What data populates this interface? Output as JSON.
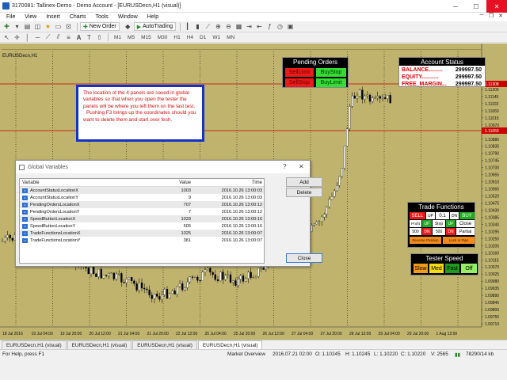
{
  "window": {
    "title": "3170081: Tallinex-Demo - Demo Account - [EURUSDecn,H1 (visual)]"
  },
  "menu": [
    "File",
    "View",
    "Insert",
    "Charts",
    "Tools",
    "Window",
    "Help"
  ],
  "toolbar": {
    "new_order": "New Order",
    "autotrading": "AutoTrading",
    "timeframes": [
      "M1",
      "M5",
      "M15",
      "M30",
      "H1",
      "H4",
      "D1",
      "W1",
      "MN"
    ]
  },
  "chart": {
    "symbol_label": "EURUSDecn,H1",
    "price_levels": [
      "1.11308",
      "1.11205",
      "1.11145",
      "1.11102",
      "1.11060",
      "1.11015",
      "1.10970",
      "1.10925",
      "1.10880",
      "1.10835",
      "1.10790",
      "1.10745",
      "1.10700",
      "1.10655",
      "1.10610",
      "1.10565",
      "1.10520",
      "1.10475",
      "1.10430",
      "1.10385",
      "1.10340",
      "1.10295",
      "1.10250",
      "1.10205",
      "1.10160",
      "1.10115",
      "1.10070",
      "1.10025",
      "1.09980",
      "1.09935",
      "1.09890",
      "1.09845",
      "1.09800",
      "1.09755",
      "1.09710"
    ],
    "price_line_top": "1.11308",
    "price_line_mid": "1.11050",
    "time_labels": [
      "18 Jul 2016",
      "19 Jul 04:00",
      "19 Jul 20:00",
      "20 Jul 12:00",
      "21 Jul 04:00",
      "21 Jul 20:00",
      "22 Jul 12:00",
      "25 Jul 04:00",
      "25 Jul 20:00",
      "26 Jul 12:00",
      "27 Jul 04:00",
      "27 Jul 20:00",
      "28 Jul 12:00",
      "29 Jul 04:00",
      "29 Jul 20:00",
      "1 Aug 12:00"
    ],
    "colors": {
      "background": "#bfb36d",
      "bull": "#ffffff",
      "bear": "#000000",
      "level": "#cc0000"
    }
  },
  "pending_orders": {
    "title": "Pending Orders",
    "sell_limit": "SellLimit",
    "buy_stop": "BuyStop",
    "sell_stop": "SellStop",
    "buy_limit": "BuyLimit"
  },
  "account_status": {
    "title": "Account Status",
    "rows": [
      {
        "label": "BALANCE.........",
        "value": "299997.50"
      },
      {
        "label": "EQUITY...........",
        "value": "299997.50"
      },
      {
        "label": "FREE_MARGIN...",
        "value": "299997.50"
      }
    ]
  },
  "note": {
    "text1": "The location of the 4 panels are saved in global variables so that when you open the tester the panels will be where you left them on the last test.",
    "text2": "Pushing F3 brings up the coordinates should you want to delete them and start over fesh."
  },
  "global_variables": {
    "title": "Global Variables",
    "help": "?",
    "close_icon": "close-icon",
    "columns": {
      "variable": "Variable",
      "value": "Value",
      "time": "Time"
    },
    "rows": [
      {
        "name": "AccountStatusLocationX",
        "value": "1003",
        "time": "2016.10.26 13:00:03"
      },
      {
        "name": "AccountStatusLocationY",
        "value": "9",
        "time": "2016.10.26 13:00:03"
      },
      {
        "name": "PendingOrdersLocationX",
        "value": "707",
        "time": "2016.10.26 13:00:12"
      },
      {
        "name": "PendingOrdersLocationY",
        "value": "7",
        "time": "2016.10.26 13:00:12"
      },
      {
        "name": "SpeedButtonLocationX",
        "value": "1033",
        "time": "2016.10.26 13:00:16"
      },
      {
        "name": "SpeedButtonLocationY",
        "value": "505",
        "time": "2016.10.26 13:00:16"
      },
      {
        "name": "TradeFunctionsLocationX",
        "value": "1025",
        "time": "2016.10.26 13:00:07"
      },
      {
        "name": "TradeFunctionsLocationY",
        "value": "381",
        "time": "2016.10.26 13:00:07"
      }
    ],
    "add": "Add",
    "delete": "Delete",
    "close": "Close"
  },
  "trade_functions": {
    "title": "Trade Functions",
    "sell": "SELL",
    "up": "UP",
    "lot": "0.1",
    "dn": "DN",
    "buy": "BUY",
    "profit": "Profit",
    "up2": "UP",
    "stop": "Stop",
    "up3": "UP",
    "close": "Close",
    "v500a": "500",
    "dn2": "DN",
    "v500b": "500",
    "dn3": "DN",
    "partial": "Partial",
    "reverse": "Reverse Position",
    "lock": "Lock in Pips"
  },
  "tester_speed": {
    "title": "Tester Speed",
    "slow": "Slow",
    "med": "Med",
    "fast": "Fast",
    "off": "Off"
  },
  "tabs": [
    "EURUSDecn,H1 (visual)",
    "EURUSDecn,H1 (visual)",
    "EURUSDecn,H1 (visual)",
    "EURUSDecn,H1 (visual)"
  ],
  "status": {
    "help": "For Help, press F1",
    "profile": "Market Overview",
    "datetime": "2016.07.21 02:00",
    "open": "O: 1.10245",
    "high": "H: 1.10245",
    "low": "L: 1.10220",
    "close": "C: 1.10220",
    "volume": "V: 2565",
    "traffic": "78290/14 kb"
  }
}
